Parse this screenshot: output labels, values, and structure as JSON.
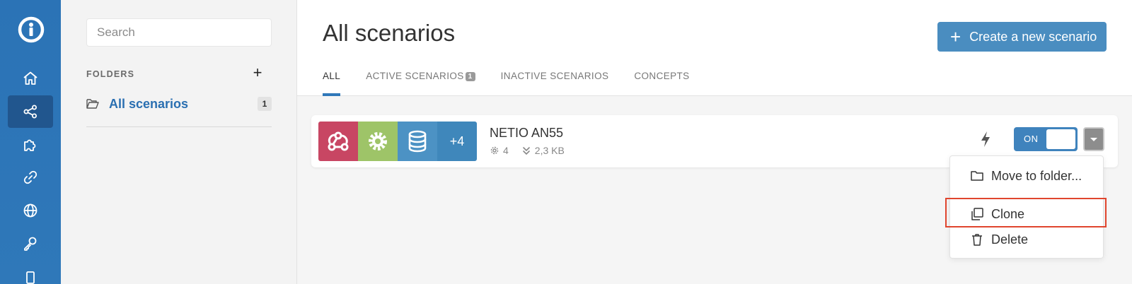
{
  "nav": {
    "items": [
      "home-icon",
      "share-icon",
      "puzzle-icon",
      "link-icon",
      "globe-icon",
      "key-icon",
      "device-icon"
    ],
    "active": "share-icon",
    "accent": "#2f78b9"
  },
  "folders": {
    "search_placeholder": "Search",
    "label": "FOLDERS",
    "add_label": "+",
    "items": [
      {
        "name": "All scenarios",
        "count": "1"
      }
    ]
  },
  "header": {
    "title": "All scenarios",
    "create_button": {
      "plus": "+",
      "label": "Create a new scenario"
    },
    "tabs": [
      {
        "label": "ALL",
        "active": true
      },
      {
        "label": "ACTIVE SCENARIOS",
        "badge": "1"
      },
      {
        "label": "INACTIVE SCENARIOS"
      },
      {
        "label": "CONCEPTS"
      }
    ]
  },
  "scenario": {
    "name": "NETIO AN55",
    "modules": [
      "webhook-icon",
      "tools-icon",
      "datastore-icon"
    ],
    "more_modules": "+4",
    "operations": "4",
    "size": "2,3 KB",
    "toggle_label": "ON",
    "colors": {
      "webhook": "#c84663",
      "tools": "#9ec468",
      "datastore": "#4c92c4",
      "more": "#3f87bb"
    }
  },
  "menu": {
    "items": [
      {
        "label": "Move to folder...",
        "icon": "folder-icon"
      },
      {
        "label": "Clone",
        "icon": "clone-icon",
        "highlighted": true
      },
      {
        "label": "Delete",
        "icon": "trash-icon"
      }
    ],
    "highlight_color": "#e0452e"
  }
}
